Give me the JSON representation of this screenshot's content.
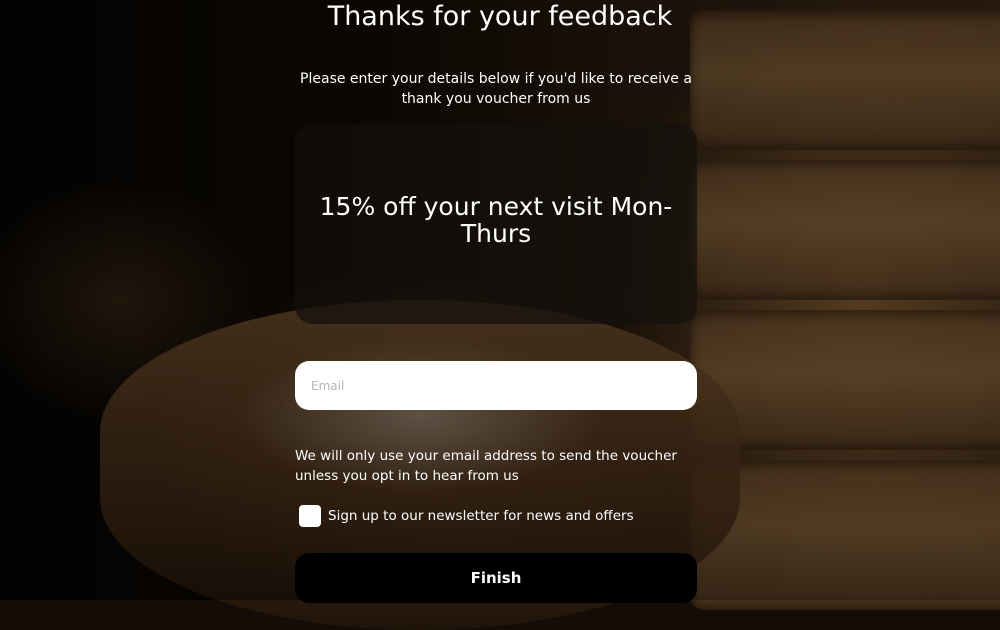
{
  "page": {
    "title": "Thanks for your feedback",
    "intro": "Please enter your details below if you'd like to receive a thank you voucher from us"
  },
  "voucher": {
    "text": "15% off your next visit Mon-Thurs"
  },
  "form": {
    "email": {
      "value": "",
      "placeholder": "Email"
    },
    "privacy_note": "We will only use your email address to send the voucher unless you opt in to hear from us",
    "newsletter": {
      "label": "Sign up to our newsletter for news and offers",
      "checked": false
    },
    "finish_label": "Finish"
  },
  "colors": {
    "text": "#ffffff",
    "field_background": "#ffffff",
    "button_background": "#000000",
    "voucher_box": "#14100c"
  }
}
